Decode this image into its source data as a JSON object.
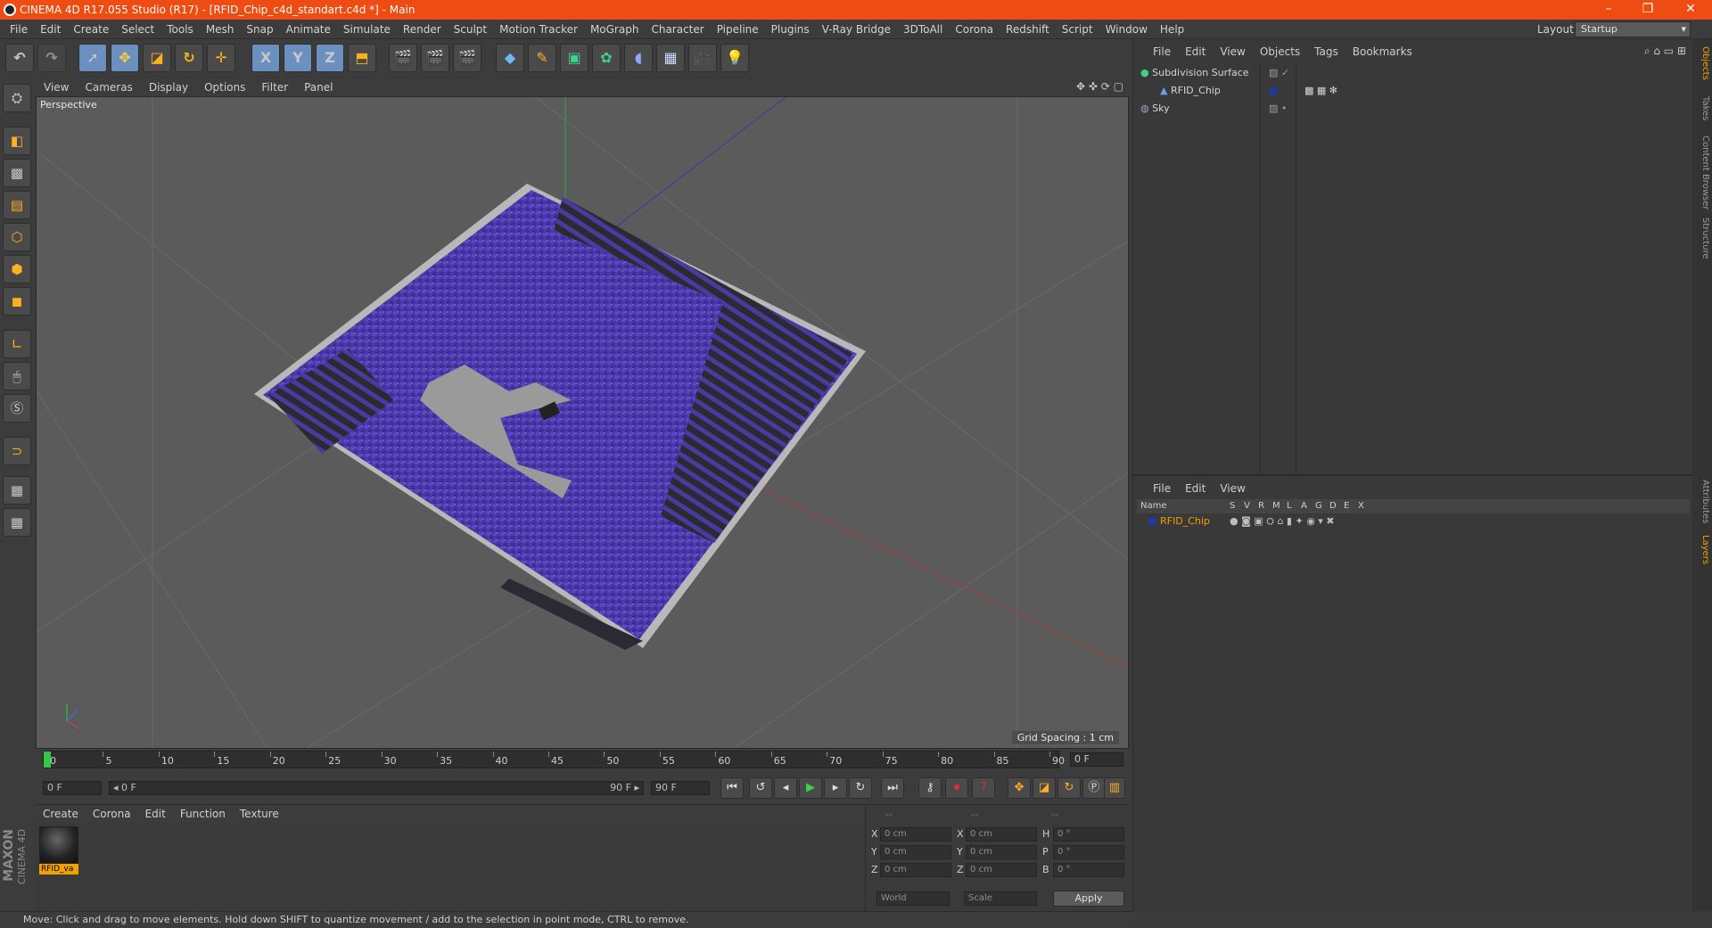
{
  "window": {
    "title": "CINEMA 4D R17.055 Studio (R17) - [RFID_Chip_c4d_standart.c4d *] - Main",
    "min_glyph": "–",
    "restore_glyph": "❐",
    "close_glyph": "✕"
  },
  "menu": {
    "items": [
      "File",
      "Edit",
      "Create",
      "Select",
      "Tools",
      "Mesh",
      "Snap",
      "Animate",
      "Simulate",
      "Render",
      "Sculpt",
      "Motion Tracker",
      "MoGraph",
      "Character",
      "Pipeline",
      "Plugins",
      "V-Ray Bridge",
      "3DToAll",
      "Corona",
      "Redshift",
      "Script",
      "Window",
      "Help"
    ],
    "layout_label": "Layout:",
    "layout_value": "Startup"
  },
  "toolbar": {
    "undo_icon": "↶",
    "redo_icon": "↷",
    "x_label": "X",
    "y_label": "Y",
    "z_label": "Z"
  },
  "viewport": {
    "menu": [
      "View",
      "Cameras",
      "Display",
      "Options",
      "Filter",
      "Panel"
    ],
    "label": "Perspective",
    "grid_spacing": "Grid Spacing : 1 cm"
  },
  "timeline": {
    "ticks": [
      "0",
      "5",
      "10",
      "15",
      "20",
      "25",
      "30",
      "35",
      "40",
      "45",
      "50",
      "55",
      "60",
      "65",
      "70",
      "75",
      "80",
      "85",
      "90"
    ],
    "current_frame": "0 F"
  },
  "transport": {
    "start_field": "0 F",
    "range_start": "◂ 0 F",
    "range_end": "90 F ▸",
    "end_field": "90 F"
  },
  "materials": {
    "menu": [
      "Create",
      "Corona",
      "Edit",
      "Function",
      "Texture"
    ],
    "items": [
      {
        "name": "RFID_va"
      }
    ]
  },
  "coordinates": {
    "header": [
      "--",
      "--",
      "--"
    ],
    "rows": [
      {
        "a": "X",
        "av": "0 cm",
        "b": "X",
        "bv": "0 cm",
        "c": "H",
        "cv": "0 °"
      },
      {
        "a": "Y",
        "av": "0 cm",
        "b": "Y",
        "bv": "0 cm",
        "c": "P",
        "cv": "0 °"
      },
      {
        "a": "Z",
        "av": "0 cm",
        "b": "Z",
        "bv": "0 cm",
        "c": "B",
        "cv": "0 °"
      }
    ],
    "mode1": "World",
    "mode2": "Scale",
    "apply": "Apply"
  },
  "objects": {
    "menu": [
      "File",
      "Edit",
      "View",
      "Objects",
      "Tags",
      "Bookmarks"
    ],
    "tree": [
      {
        "name": "Subdivision Surface",
        "color": "#3fd18a"
      },
      {
        "name": "RFID_Chip",
        "color": "#6aa0e8"
      },
      {
        "name": "Sky",
        "color": "#9aa6c0"
      }
    ]
  },
  "layers": {
    "menu": [
      "File",
      "Edit",
      "View"
    ],
    "columns": [
      "Name",
      "S",
      "V",
      "R",
      "M",
      "L",
      "A",
      "G",
      "D",
      "E",
      "X"
    ],
    "rows": [
      {
        "name": "RFID_Chip",
        "color": "#1e3a9e"
      }
    ]
  },
  "right_tabs": [
    "Objects",
    "Takes",
    "Content Browser",
    "Structure",
    "Attributes",
    "Layers"
  ],
  "brand": {
    "line1": "MAXON",
    "line2": "CINEMA 4D"
  },
  "status": "Move: Click and drag to move elements. Hold down SHIFT to quantize movement / add to the selection in point mode, CTRL to remove."
}
